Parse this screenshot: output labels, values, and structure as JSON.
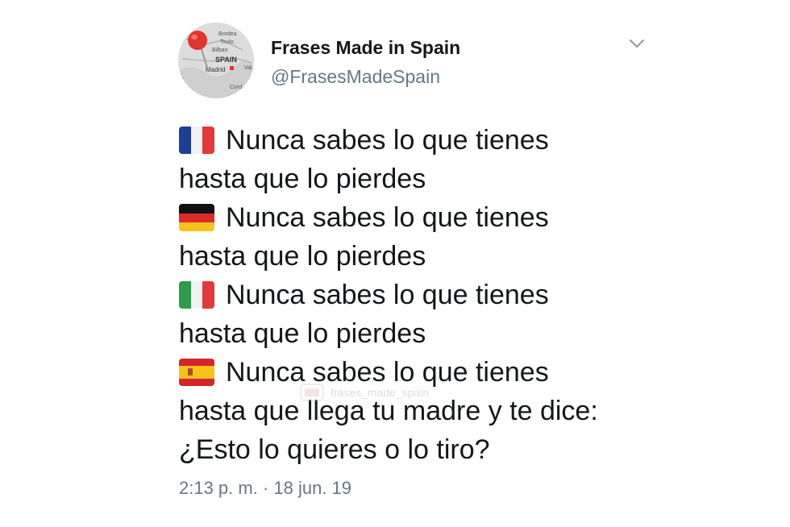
{
  "author": {
    "name": "Frases Made in Spain",
    "handle": "@FrasesMadeSpain",
    "avatar": {
      "map_labels": [
        "SPAIN",
        "Madrid",
        "Bordea",
        "Toulo",
        "Bilbao",
        "L",
        "Val",
        "Cord"
      ]
    }
  },
  "tweet": {
    "lines": [
      {
        "flag": "france-flag-icon",
        "text": "Nunca sabes lo que tienes"
      },
      {
        "text": "hasta que lo pierdes"
      },
      {
        "flag": "germany-flag-icon",
        "text": "Nunca sabes lo que tienes"
      },
      {
        "text": "hasta que lo pierdes"
      },
      {
        "flag": "italy-flag-icon",
        "text": "Nunca sabes lo que tienes"
      },
      {
        "text": "hasta que lo pierdes"
      },
      {
        "flag": "spain-flag-icon",
        "text": "Nunca sabes lo que tienes"
      },
      {
        "text": "hasta que llega tu madre y te dice:"
      },
      {
        "text": "¿Esto lo quieres o lo tiro?"
      }
    ],
    "timestamp": "2:13 p. m. · 18 jun. 19",
    "watermark": "frases_made_spain"
  },
  "colors": {
    "text_primary": "#14171a",
    "text_secondary": "#657786",
    "pin_red": "#e0362f"
  },
  "icons": {
    "menu": "chevron-down-icon"
  }
}
